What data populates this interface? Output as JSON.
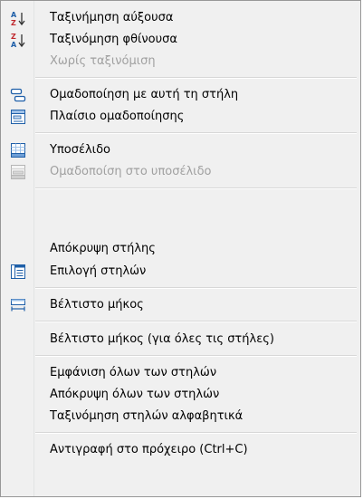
{
  "menu": {
    "items": [
      {
        "label": "Ταξινήμηση αύξουσα",
        "icon": "sort-ascending-icon",
        "enabled": true
      },
      {
        "label": "Ταξινόμηση φθίνουσα",
        "icon": "sort-descending-icon",
        "enabled": true
      },
      {
        "label": "Χωρίς ταξινόμιση",
        "icon": "",
        "enabled": false
      },
      {
        "label": "Ομαδοποίηση με αυτή τη στήλη",
        "icon": "group-by-column-icon",
        "enabled": true
      },
      {
        "label": "Πλαίσιο ομαδοποίησης",
        "icon": "group-box-icon",
        "enabled": true
      },
      {
        "label": "Υποσέλιδο",
        "icon": "footer-icon",
        "enabled": true
      },
      {
        "label": "Ομαδοποίση στο υποσέλιδο",
        "icon": "group-footer-icon",
        "enabled": false
      },
      {
        "label": "Απόκρυψη στήλης",
        "icon": "",
        "enabled": true
      },
      {
        "label": "Επιλογή στηλών",
        "icon": "column-chooser-icon",
        "enabled": true
      },
      {
        "label": "Βέλτιστο μήκος",
        "icon": "best-fit-icon",
        "enabled": true
      },
      {
        "label": "Βέλτιστο μήκος (για όλες τις στήλες)",
        "icon": "",
        "enabled": true
      },
      {
        "label": "Εμφάνιση όλων των στηλών",
        "icon": "",
        "enabled": true
      },
      {
        "label": "Απόκρυψη όλων των στηλών",
        "icon": "",
        "enabled": true
      },
      {
        "label": "Ταξινόμηση στηλών αλφαβητικά",
        "icon": "",
        "enabled": true
      },
      {
        "label": "Αντιγραφή στο πρόχειρο (Ctrl+C)",
        "icon": "",
        "enabled": true
      }
    ]
  },
  "colors": {
    "menu_background": "#f0f0f0",
    "disabled_text": "#a0a0a0",
    "icon_blue": "#1f5fa8",
    "icon_red": "#c0282d"
  }
}
